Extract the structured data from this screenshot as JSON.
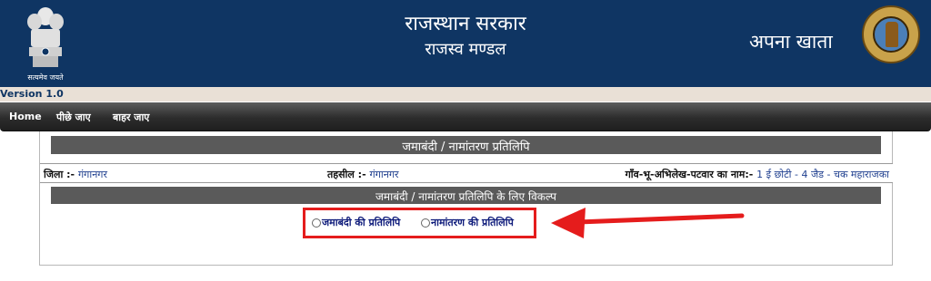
{
  "header": {
    "emblem_motto": "सत्यमेव जयते",
    "title": "राजस्थान सरकार",
    "subtitle": "राजस्व मण्डल",
    "app_name": "अपना खाता"
  },
  "version": "Version 1.0",
  "nav": {
    "items": [
      {
        "label": "Home"
      },
      {
        "label": "पीछे जाए"
      },
      {
        "label": "बाहर जाए"
      }
    ]
  },
  "section": {
    "title": "जमाबंदी / नामांतरण प्रतिलिपि",
    "district_label": "जिला :-",
    "district_value": "गंगानगर",
    "tehsil_label": "तहसील :-",
    "tehsil_value": "गंगानगर",
    "village_label": "गाँव-भू-अभिलेख-पटवार का नाम:-",
    "village_value": "1 ई छोटी - 4 जैड - चक महाराजका",
    "options_title": "जमाबंदी / नामांतरण प्रतिलिपि के लिए विकल्प"
  },
  "options": [
    {
      "label": "जमाबंदी की प्रतिलिपि",
      "selected": false
    },
    {
      "label": "नामांतरण की प्रतिलिपि",
      "selected": false
    }
  ],
  "colors": {
    "header_bg": "#0f3563",
    "highlight_box": "#e51c1c",
    "arrow": "#e51c1c",
    "section_header_bg": "#5a5a5a"
  }
}
